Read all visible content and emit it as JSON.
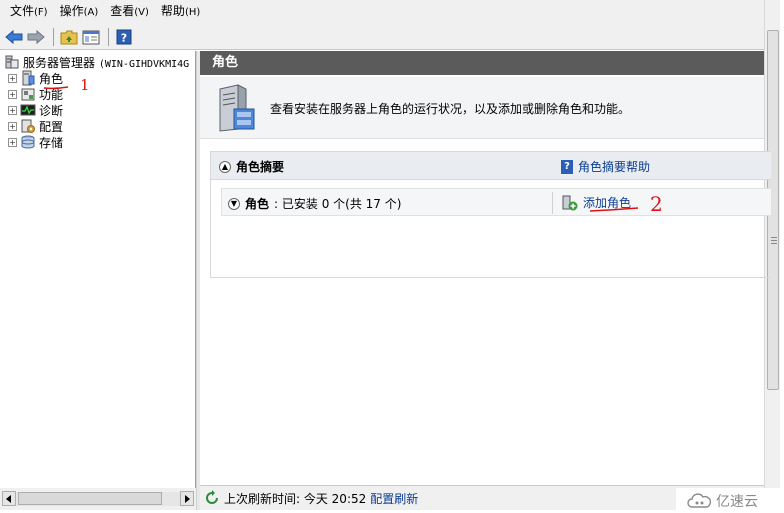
{
  "menubar": {
    "items": [
      {
        "label": "文件",
        "key": "(F)"
      },
      {
        "label": "操作",
        "key": "(A)"
      },
      {
        "label": "查看",
        "key": "(V)"
      },
      {
        "label": "帮助",
        "key": "(H)"
      }
    ]
  },
  "tree": {
    "root": {
      "label": "服务器管理器",
      "suffix": "(WIN-GIHDVKMI4G"
    },
    "items": [
      {
        "label": "角色"
      },
      {
        "label": "功能"
      },
      {
        "label": "诊断"
      },
      {
        "label": "配置"
      },
      {
        "label": "存储"
      }
    ],
    "expander_symbol": "+"
  },
  "annotations": {
    "one": "1",
    "two": "2"
  },
  "main": {
    "header": "角色",
    "intro": "查看安装在服务器上角色的运行状况，以及添加或删除角色和功能。",
    "section": {
      "title": "角色摘要",
      "help_link": "角色摘要帮助",
      "roles_label": "角色",
      "roles_status": ": 已安装 0 个(共 17 个)",
      "add_roles": "添加角色"
    }
  },
  "status": {
    "last_refresh": "上次刷新时间: 今天 20:52",
    "configure_refresh": "配置刷新"
  },
  "watermark": {
    "text": "亿速云"
  },
  "colors": {
    "header_bg": "#5b5b5b",
    "link": "#0b3d91",
    "annotation": "#e01010",
    "panel_bg": "#f3f4f6"
  }
}
